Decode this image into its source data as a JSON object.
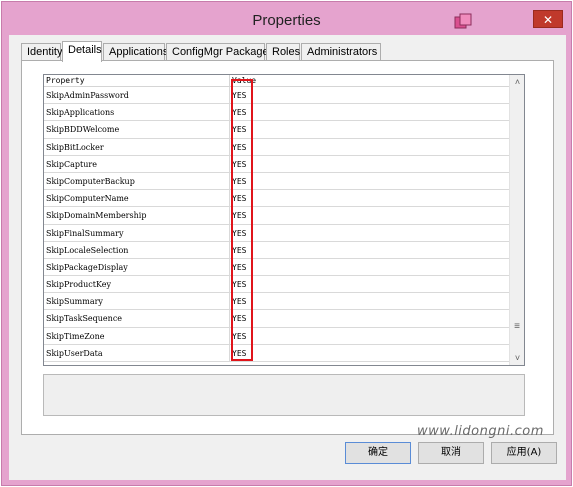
{
  "window": {
    "title": "Properties",
    "close_label": "✕"
  },
  "tabs": [
    {
      "label": "Identity"
    },
    {
      "label": "Details"
    },
    {
      "label": "Applications"
    },
    {
      "label": "ConfigMgr Packages"
    },
    {
      "label": "Roles"
    },
    {
      "label": "Administrators"
    }
  ],
  "grid": {
    "header": {
      "property": "Property",
      "value": "Value"
    },
    "rows": [
      {
        "property": "SkipAdminPassword",
        "value": "YES"
      },
      {
        "property": "SkipApplications",
        "value": "YES"
      },
      {
        "property": "SkipBDDWelcome",
        "value": "YES"
      },
      {
        "property": "SkipBitLocker",
        "value": "YES"
      },
      {
        "property": "SkipCapture",
        "value": "YES"
      },
      {
        "property": "SkipComputerBackup",
        "value": "YES"
      },
      {
        "property": "SkipComputerName",
        "value": "YES"
      },
      {
        "property": "SkipDomainMembership",
        "value": "YES"
      },
      {
        "property": "SkipFinalSummary",
        "value": "YES"
      },
      {
        "property": "SkipLocaleSelection",
        "value": "YES"
      },
      {
        "property": "SkipPackageDisplay",
        "value": "YES"
      },
      {
        "property": "SkipProductKey",
        "value": "YES"
      },
      {
        "property": "SkipSummary",
        "value": "YES"
      },
      {
        "property": "SkipTaskSequence",
        "value": "YES"
      },
      {
        "property": "SkipTimeZone",
        "value": "YES"
      },
      {
        "property": "SkipUserData",
        "value": "YES"
      }
    ],
    "scrollbar": {
      "up": "˄",
      "down": "˅",
      "thumb": "≡"
    }
  },
  "buttons": {
    "ok": "确定",
    "cancel": "取消",
    "apply": "应用(A)"
  },
  "watermark": "www.lidongni.com",
  "colors": {
    "title_bar": "#e5a3ce",
    "highlight": "#e0141b",
    "close": "#c0392b"
  }
}
